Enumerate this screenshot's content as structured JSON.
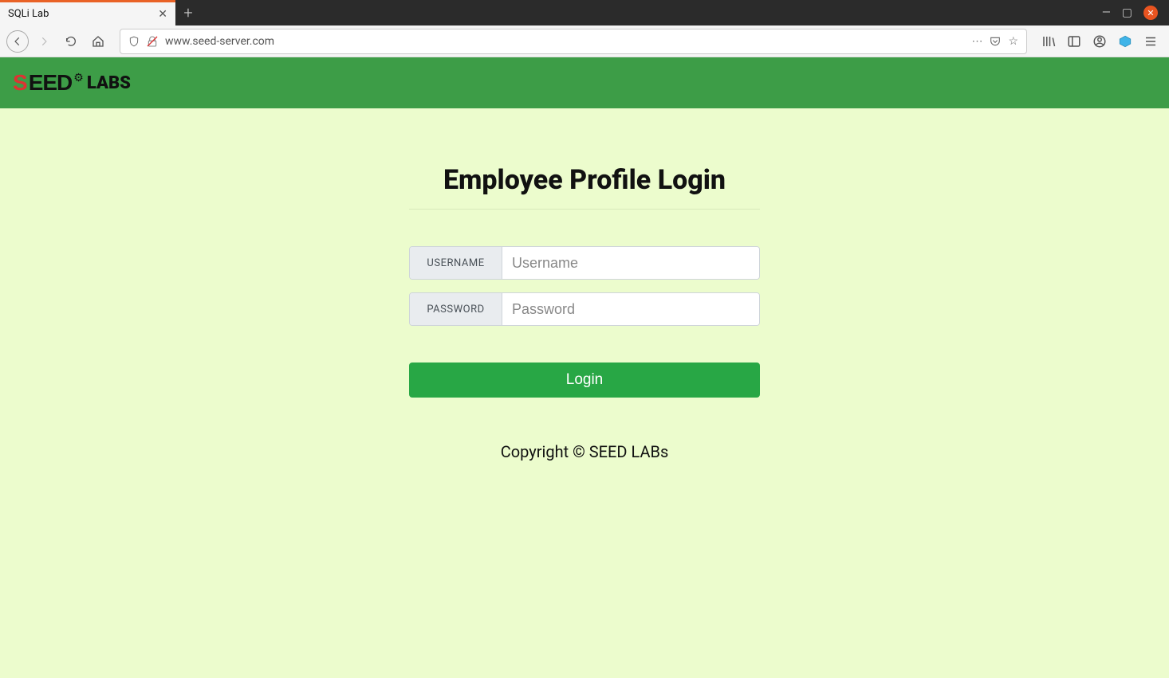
{
  "browser": {
    "tab_title": "SQLi Lab",
    "url": "www.seed-server.com"
  },
  "page": {
    "logo": {
      "seed_red": "S",
      "seed_black": "EED",
      "gear": "⚙",
      "labs": "LABS"
    },
    "title": "Employee Profile Login",
    "form": {
      "username_label": "USERNAME",
      "username_placeholder": "Username",
      "username_value": "",
      "password_label": "PASSWORD",
      "password_placeholder": "Password",
      "password_value": "",
      "login_label": "Login"
    },
    "footer": "Copyright © SEED LABs"
  },
  "colors": {
    "header_green": "#3d9d47",
    "page_bg": "#ecfccd",
    "btn_green": "#28a745",
    "tab_accent": "#e96226"
  }
}
